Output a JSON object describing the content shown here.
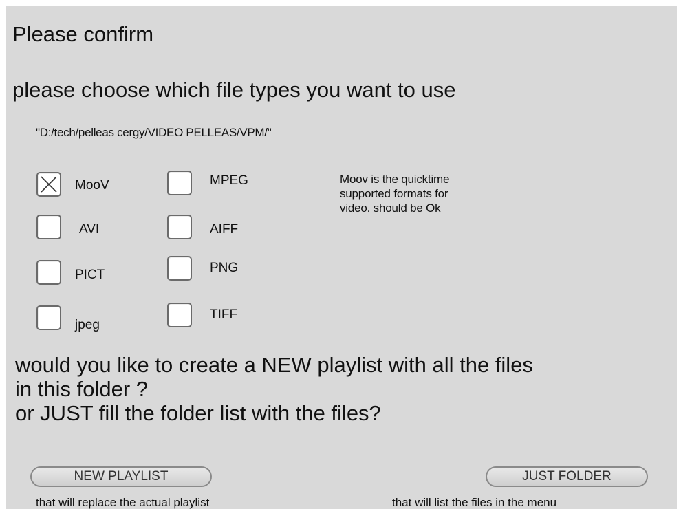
{
  "dialog": {
    "title": "Please confirm",
    "subtitle": "please choose which file types you want to use",
    "path": "\"D:/tech/pelleas cergy/VIDEO PELLEAS/VPM/\"",
    "file_types": [
      {
        "label": "MooV",
        "checked": true
      },
      {
        "label": "AVI",
        "checked": false
      },
      {
        "label": "PICT",
        "checked": false
      },
      {
        "label": "jpeg",
        "checked": false
      },
      {
        "label": "MPEG",
        "checked": false
      },
      {
        "label": "AIFF",
        "checked": false
      },
      {
        "label": "PNG",
        "checked": false
      },
      {
        "label": "TIFF",
        "checked": false
      }
    ],
    "note": {
      "line1": "Moov is the quicktime",
      "line2": "supported formats for",
      "line3": "video. should be Ok"
    },
    "question": {
      "line1": "would you like to create a NEW playlist with all the files",
      "line2": "in this folder ?",
      "line3": "or JUST fill the folder list with the files?"
    },
    "new_playlist": {
      "label": "NEW PLAYLIST",
      "note": "that will replace the actual playlist"
    },
    "just_folder": {
      "label": "JUST FOLDER",
      "note": "that will list the files in the menu"
    }
  }
}
